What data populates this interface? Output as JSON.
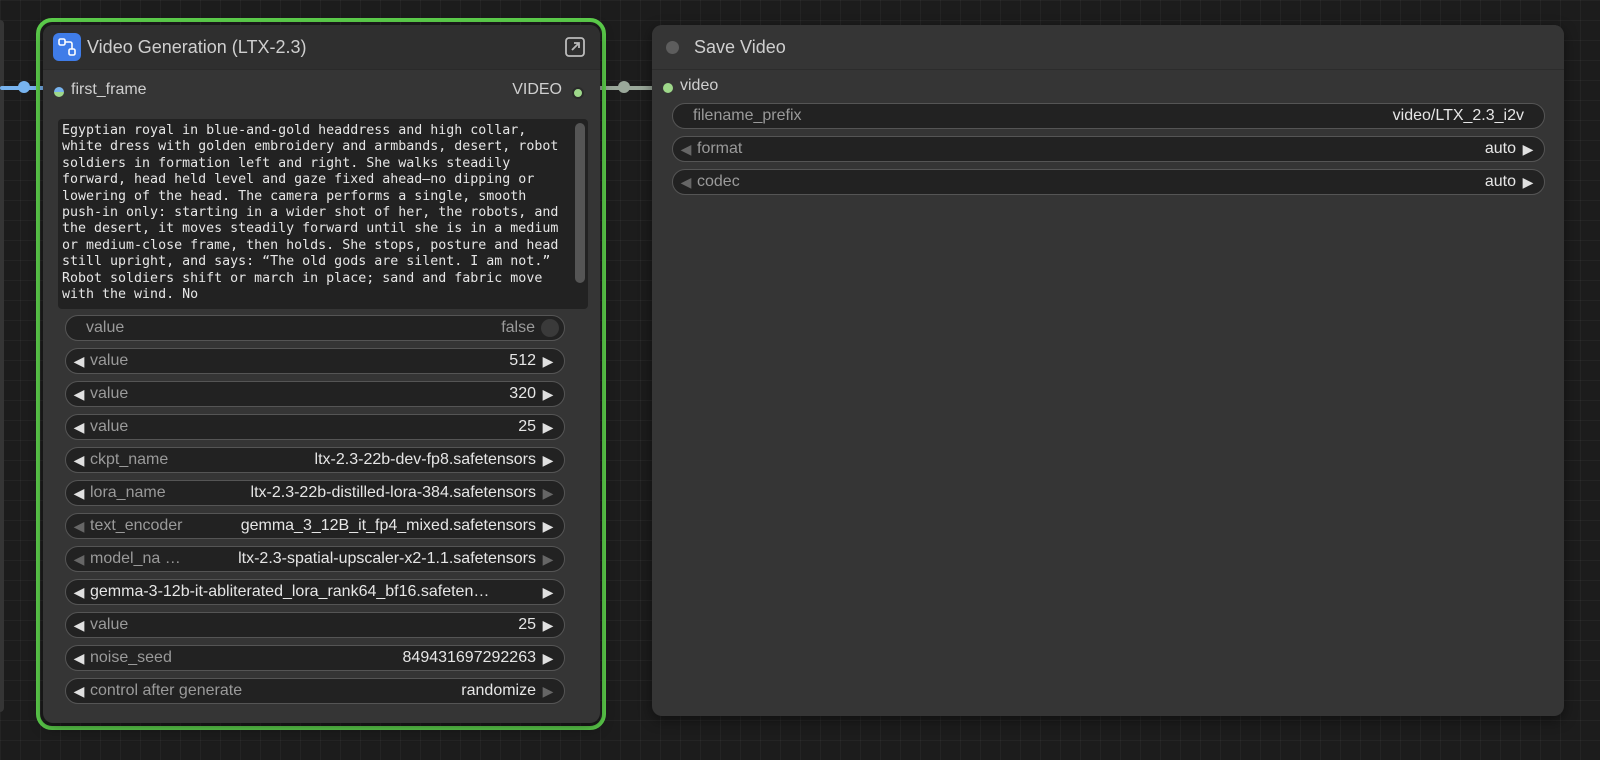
{
  "colors": {
    "selected_outline": "#5dd04c",
    "icon_bg": "#3f7ce8",
    "image_slot": "#78b4ef",
    "video_slot": "#9ed88a"
  },
  "generation_node": {
    "title": "Video Generation (LTX-2.3)",
    "icon": "subgraph-icon",
    "input_label": "first_frame",
    "output_label": "VIDEO",
    "prompt": "Egyptian royal in blue-and-gold headdress and high collar, white dress with golden embroidery and armbands, desert, robot soldiers in formation left and right. She walks steadily forward, head held level and gaze fixed ahead—no dipping or lowering of the head. The camera performs a single, smooth push-in only: starting in a wider shot of her, the robots, and the desert, it moves steadily forward until she is in a medium or medium-close frame, then holds. She stops, posture and head still upright, and says: “The old gods are silent. I am not.” Robot soldiers shift or march in place; sand and fabric move with the wind. No",
    "widgets": [
      {
        "label": "value",
        "value": "false",
        "kind": "toggle"
      },
      {
        "label": "value",
        "value": "512",
        "kind": "number"
      },
      {
        "label": "value",
        "value": "320",
        "kind": "number"
      },
      {
        "label": "value",
        "value": "25",
        "kind": "number"
      },
      {
        "label": "ckpt_name",
        "value": "ltx-2.3-22b-dev-fp8.safetensors",
        "kind": "combo"
      },
      {
        "label": "lora_name",
        "value": "ltx-2.3-22b-distilled-lora-384.safetensors",
        "kind": "combo"
      },
      {
        "label": "text_encoder",
        "value": "gemma_3_12B_it_fp4_mixed.safetensors",
        "kind": "combo"
      },
      {
        "label": "model_na …",
        "value": "ltx-2.3-spatial-upscaler-x2-1.1.safetensors",
        "kind": "combo"
      },
      {
        "label": "",
        "value": "gemma-3-12b-it-abliterated_lora_rank64_bf16.safeten…",
        "kind": "combo"
      },
      {
        "label": "value",
        "value": "25",
        "kind": "number"
      },
      {
        "label": "noise_seed",
        "value": "849431697292263",
        "kind": "number"
      },
      {
        "label": "control after generate",
        "value": "randomize",
        "kind": "combo"
      }
    ]
  },
  "save_node": {
    "title": "Save Video",
    "input_label": "video",
    "widgets": [
      {
        "label": "filename_prefix",
        "value": "video/LTX_2.3_i2v",
        "kind": "text"
      },
      {
        "label": "format",
        "value": "auto",
        "kind": "combo"
      },
      {
        "label": "codec",
        "value": "auto",
        "kind": "combo"
      }
    ]
  }
}
